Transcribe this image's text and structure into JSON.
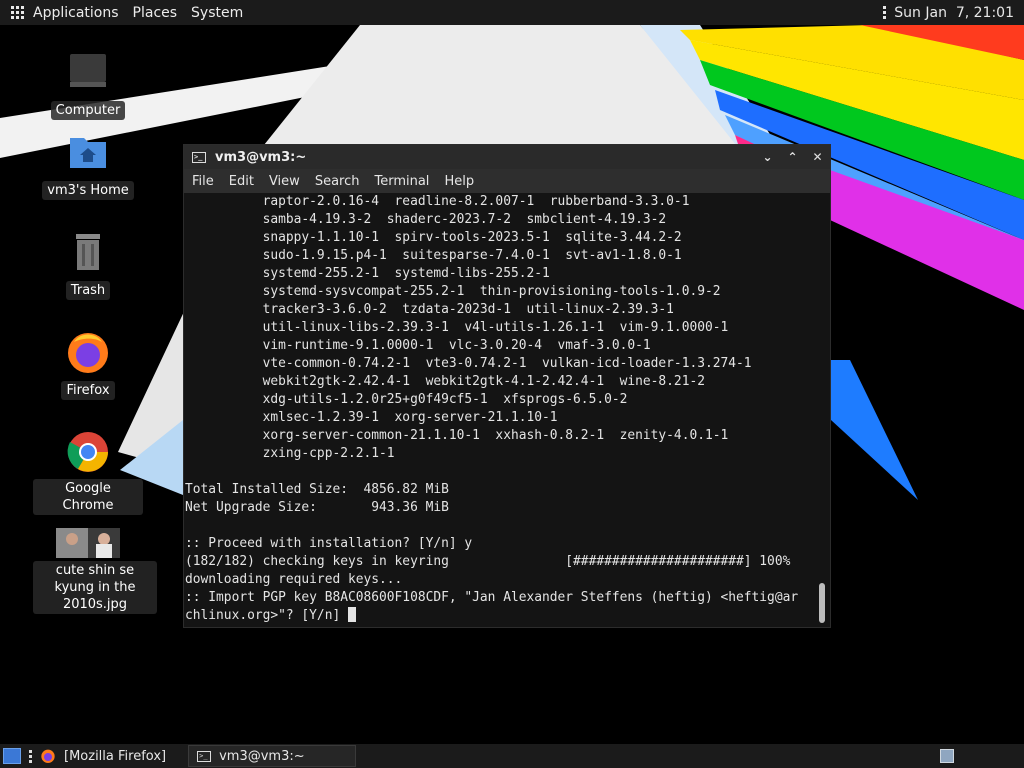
{
  "top_panel": {
    "menus": [
      "Applications",
      "Places",
      "System"
    ],
    "clock": "Sun Jan  7, 21:01"
  },
  "desktop": {
    "icons": [
      {
        "label": "Computer"
      },
      {
        "label": "vm3's Home"
      },
      {
        "label": "Trash"
      },
      {
        "label": "Firefox"
      },
      {
        "label": "Google Chrome"
      },
      {
        "label": "cute shin se kyung in the 2010s.jpg"
      }
    ]
  },
  "terminal": {
    "title": "vm3@vm3:~",
    "menus": [
      "File",
      "Edit",
      "View",
      "Search",
      "Terminal",
      "Help"
    ],
    "lines": [
      "          raptor-2.0.16-4  readline-8.2.007-1  rubberband-3.3.0-1",
      "          samba-4.19.3-2  shaderc-2023.7-2  smbclient-4.19.3-2",
      "          snappy-1.1.10-1  spirv-tools-2023.5-1  sqlite-3.44.2-2",
      "          sudo-1.9.15.p4-1  suitesparse-7.4.0-1  svt-av1-1.8.0-1",
      "          systemd-255.2-1  systemd-libs-255.2-1",
      "          systemd-sysvcompat-255.2-1  thin-provisioning-tools-1.0.9-2",
      "          tracker3-3.6.0-2  tzdata-2023d-1  util-linux-2.39.3-1",
      "          util-linux-libs-2.39.3-1  v4l-utils-1.26.1-1  vim-9.1.0000-1",
      "          vim-runtime-9.1.0000-1  vlc-3.0.20-4  vmaf-3.0.0-1",
      "          vte-common-0.74.2-1  vte3-0.74.2-1  vulkan-icd-loader-1.3.274-1",
      "          webkit2gtk-2.42.4-1  webkit2gtk-4.1-2.42.4-1  wine-8.21-2",
      "          xdg-utils-1.2.0r25+g0f49cf5-1  xfsprogs-6.5.0-2",
      "          xmlsec-1.2.39-1  xorg-server-21.1.10-1",
      "          xorg-server-common-21.1.10-1  xxhash-0.8.2-1  zenity-4.0.1-1",
      "          zxing-cpp-2.2.1-1",
      "",
      "Total Installed Size:  4856.82 MiB",
      "Net Upgrade Size:       943.36 MiB",
      "",
      ":: Proceed with installation? [Y/n] y",
      "(182/182) checking keys in keyring               [######################] 100%",
      "downloading required keys...",
      ":: Import PGP key B8AC08600F108CDF, \"Jan Alexander Steffens (heftig) <heftig@ar",
      "chlinux.org>\"? [Y/n] "
    ]
  },
  "taskbar": {
    "tasks": [
      "[Mozilla Firefox]",
      "vm3@vm3:~"
    ]
  }
}
